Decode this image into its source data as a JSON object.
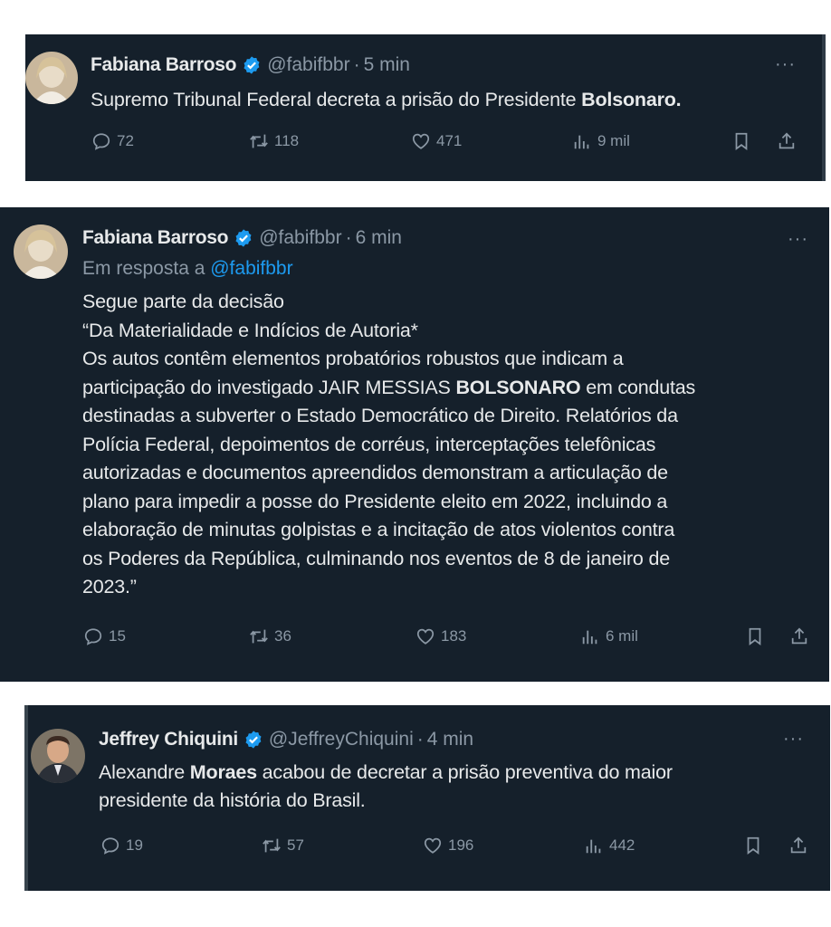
{
  "tweets": [
    {
      "author": "Fabiana Barroso",
      "handle": "@fabifbbr",
      "separator": "·",
      "time": "5 min",
      "more": "···",
      "text_lines": [
        [
          "Supremo Tribunal Federal decreta a prisão do Presidente ",
          "Bolsonaro."
        ]
      ],
      "stats": {
        "replies": "72",
        "retweets": "118",
        "likes": "471",
        "views": "9 mil"
      }
    },
    {
      "author": "Fabiana Barroso",
      "handle": "@fabifbbr",
      "separator": "·",
      "time": "6 min",
      "more": "···",
      "reply_prefix": "Em resposta a ",
      "reply_handle": "@fabifbbr",
      "text_lines": [
        "Segue parte da decisão",
        "“Da Materialidade e Indícios de Autoria*",
        "Os autos contêm elementos probatórios robustos que indicam a",
        [
          "participação do investigado JAIR MESSIAS ",
          "BOLSONARO",
          " em condutas"
        ],
        "destinadas a subverter o Estado Democrático de Direito. Relatórios da",
        "Polícia Federal, depoimentos de corréus, interceptações telefônicas",
        "autorizadas e documentos apreendidos demonstram a articulação de",
        "plano para impedir a posse do Presidente eleito em 2022, incluindo a",
        "elaboração de minutas golpistas e a incitação de atos violentos contra",
        "os Poderes da República, culminando nos eventos de 8 de janeiro de",
        "2023.”"
      ],
      "stats": {
        "replies": "15",
        "retweets": "36",
        "likes": "183",
        "views": "6 mil"
      }
    },
    {
      "author": "Jeffrey Chiquini",
      "handle": "@JeffreyChiquini",
      "separator": "·",
      "time": "4 min",
      "more": "···",
      "text_lines": [
        [
          "Alexandre ",
          "Moraes",
          " acabou de decretar a prisão preventiva do maior"
        ],
        "presidente da história do Brasil."
      ],
      "stats": {
        "replies": "19",
        "retweets": "57",
        "likes": "196",
        "views": "442"
      }
    }
  ],
  "icons": {
    "verified": "verified-badge-icon",
    "reply": "reply-icon",
    "retweet": "retweet-icon",
    "like": "heart-icon",
    "views": "views-icon",
    "bookmark": "bookmark-icon",
    "share": "share-icon"
  },
  "colors": {
    "background": "#15202b",
    "text": "#e7e9ea",
    "muted": "#8b98a5",
    "accent": "#1d9bf0",
    "page": "#ffffff"
  }
}
